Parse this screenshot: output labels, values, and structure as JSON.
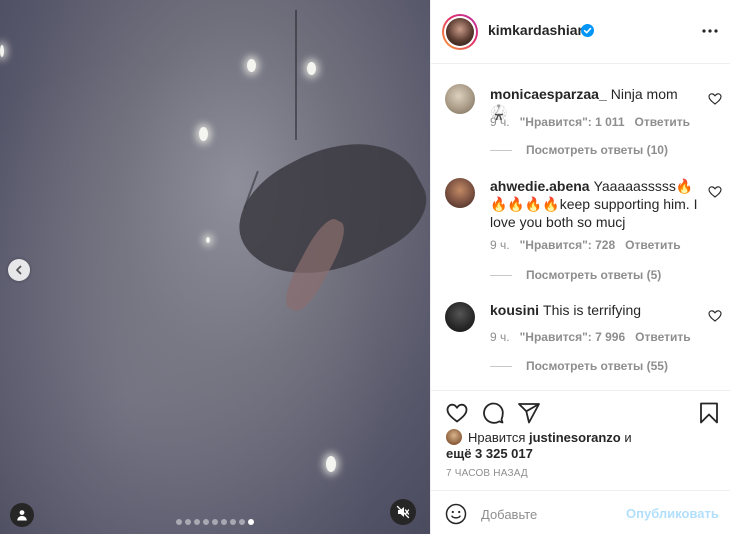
{
  "post": {
    "author": "kimkardashian",
    "verified": true,
    "media": {
      "carousel_total": 9,
      "carousel_active": 9,
      "video_muted": true
    }
  },
  "comments": [
    {
      "username": "monicaesparzaa_",
      "text": "Ninja mom 🥋",
      "time": "9 ч.",
      "likes": "\"Нравится\": 1 011",
      "reply": "Ответить",
      "view_replies": "Посмотреть ответы (10)",
      "avatar_color": "#a89a85"
    },
    {
      "username": "ahwedie.abena",
      "text": "Yaaaaasssss🔥🔥🔥🔥🔥keep supporting him. I love you both so mucj",
      "time": "9 ч.",
      "likes": "\"Нравится\": 728",
      "reply": "Ответить",
      "view_replies": "Посмотреть ответы (5)",
      "avatar_color": "#7a5040"
    },
    {
      "username": "kousini",
      "text": "This is terrifying",
      "time": "9 ч.",
      "likes": "\"Нравится\": 7 996",
      "reply": "Ответить",
      "view_replies": "Посмотреть ответы (55)",
      "avatar_color": "#2a2a2a"
    }
  ],
  "likes": {
    "prefix": "Нравится",
    "user": "justinesoranzo",
    "conj": "и",
    "others": "ещё 3 325 017"
  },
  "time_ago": "7 ЧАСОВ НАЗАД",
  "comment_box": {
    "placeholder": "Добавьте",
    "publish_label": "Опубликовать"
  },
  "colors": {
    "verified": "#0095f6",
    "publish_disabled": "#b2dffc",
    "secondary_text": "#8e8e8e"
  }
}
